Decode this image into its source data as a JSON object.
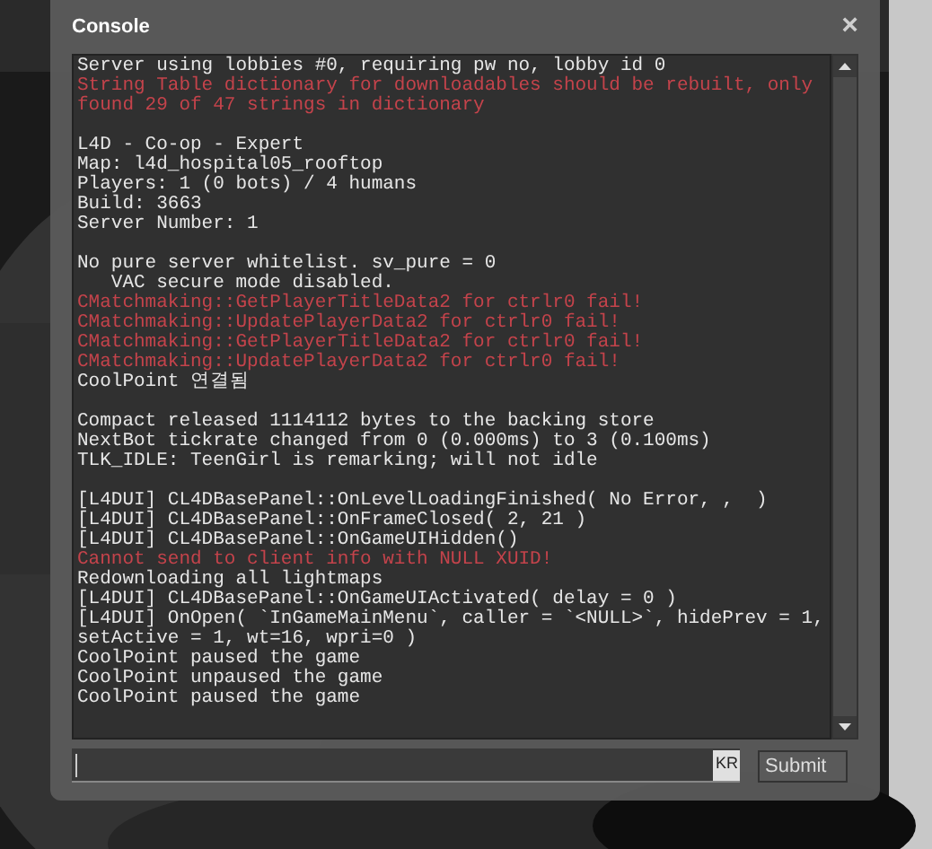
{
  "window": {
    "title": "Console",
    "close": "×"
  },
  "log": [
    {
      "kind": "normal",
      "text": "Server using lobbies #0, requiring pw no, lobby id 0"
    },
    {
      "kind": "error",
      "text": "String Table dictionary for downloadables should be rebuilt, only found 29 of 47 strings in dictionary"
    },
    {
      "kind": "blank"
    },
    {
      "kind": "normal",
      "text": "L4D - Co-op - Expert"
    },
    {
      "kind": "normal",
      "text": "Map: l4d_hospital05_rooftop"
    },
    {
      "kind": "normal",
      "text": "Players: 1 (0 bots) / 4 humans"
    },
    {
      "kind": "normal",
      "text": "Build: 3663"
    },
    {
      "kind": "normal",
      "text": "Server Number: 1"
    },
    {
      "kind": "blank"
    },
    {
      "kind": "normal",
      "text": "No pure server whitelist. sv_pure = 0"
    },
    {
      "kind": "normal",
      "text": "   VAC secure mode disabled."
    },
    {
      "kind": "error",
      "text": "CMatchmaking::GetPlayerTitleData2 for ctrlr0 fail!"
    },
    {
      "kind": "error",
      "text": "CMatchmaking::UpdatePlayerData2 for ctrlr0 fail!"
    },
    {
      "kind": "error",
      "text": "CMatchmaking::GetPlayerTitleData2 for ctrlr0 fail!"
    },
    {
      "kind": "error",
      "text": "CMatchmaking::UpdatePlayerData2 for ctrlr0 fail!"
    },
    {
      "kind": "normal",
      "text": "CoolPoint 연결됨"
    },
    {
      "kind": "blank"
    },
    {
      "kind": "normal",
      "text": "Compact released 1114112 bytes to the backing store"
    },
    {
      "kind": "normal",
      "text": "NextBot tickrate changed from 0 (0.000ms) to 3 (0.100ms)"
    },
    {
      "kind": "normal",
      "text": "TLK_IDLE: TeenGirl is remarking; will not idle"
    },
    {
      "kind": "blank"
    },
    {
      "kind": "normal",
      "text": "[L4DUI] CL4DBasePanel::OnLevelLoadingFinished( No Error, ,  )"
    },
    {
      "kind": "normal",
      "text": "[L4DUI] CL4DBasePanel::OnFrameClosed( 2, 21 )"
    },
    {
      "kind": "normal",
      "text": "[L4DUI] CL4DBasePanel::OnGameUIHidden()"
    },
    {
      "kind": "error",
      "text": "Cannot send to client info with NULL XUID!"
    },
    {
      "kind": "normal",
      "text": "Redownloading all lightmaps"
    },
    {
      "kind": "normal",
      "text": "[L4DUI] CL4DBasePanel::OnGameUIActivated( delay = 0 )"
    },
    {
      "kind": "normal",
      "text": "[L4DUI] OnOpen( `InGameMainMenu`, caller = `<NULL>`, hidePrev = 1, setActive = 1, wt=16, wpri=0 )"
    },
    {
      "kind": "normal",
      "text": "CoolPoint paused the game"
    },
    {
      "kind": "normal",
      "text": "CoolPoint unpaused the game"
    },
    {
      "kind": "normal",
      "text": "CoolPoint paused the game"
    }
  ],
  "input": {
    "ime": "KR"
  },
  "submit": "Submit"
}
